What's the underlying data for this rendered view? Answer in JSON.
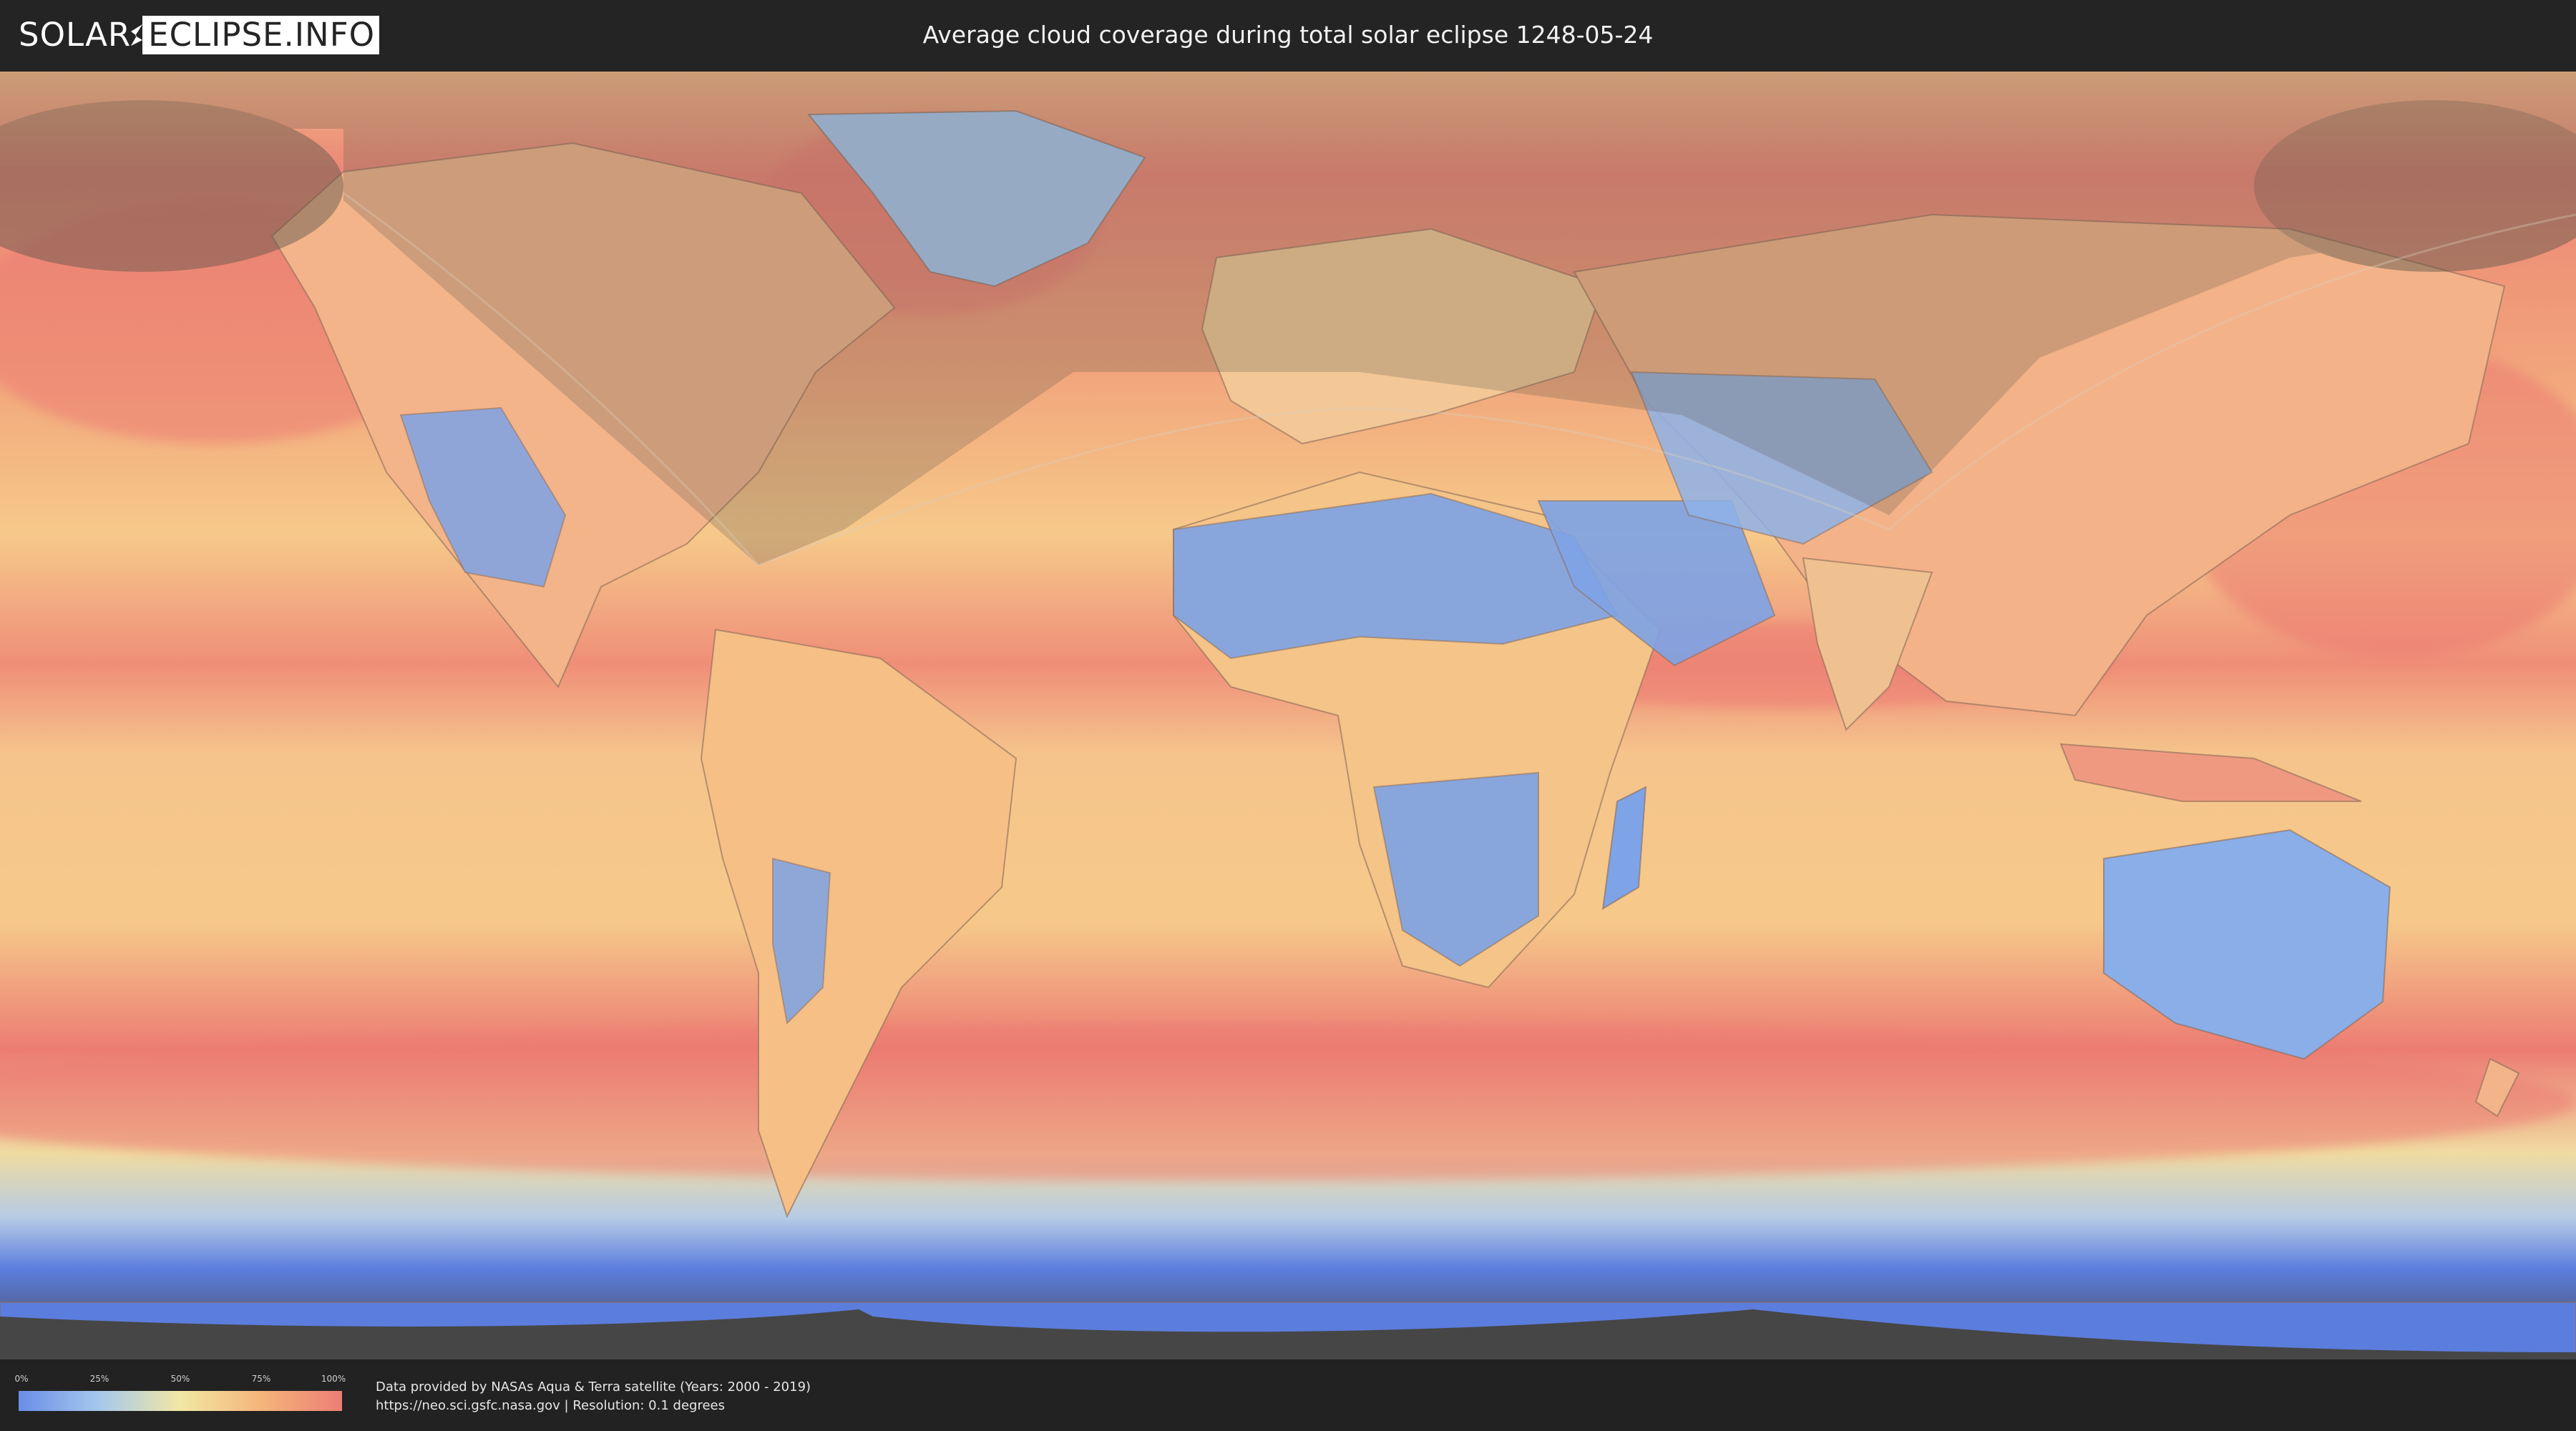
{
  "header": {
    "logo_left": "SOLAR",
    "logo_right": "ECLIPSE.INFO",
    "title": "Average cloud coverage during total solar eclipse 1248-05-24"
  },
  "legend": {
    "ticks": [
      "0%",
      "25%",
      "50%",
      "75%",
      "100%"
    ],
    "colors": [
      "#6a8ee8",
      "#a6c8ec",
      "#f2e7a4",
      "#f4b57a",
      "#ec7e76"
    ]
  },
  "credits": {
    "line1": "Data provided by NASAs Aqua & Terra satellite (Years: 2000 - 2019)",
    "line2": "https://neo.sci.gsfc.nasa.gov | Resolution: 0.1 degrees"
  },
  "map": {
    "ocean_cloud_color": "#f4b57a",
    "land_clear_color": "#7ea3e6",
    "high_cloud_color": "#ec7e76",
    "antarctica_color": "#5b7ddd",
    "shadow_color": "#5a5448"
  }
}
